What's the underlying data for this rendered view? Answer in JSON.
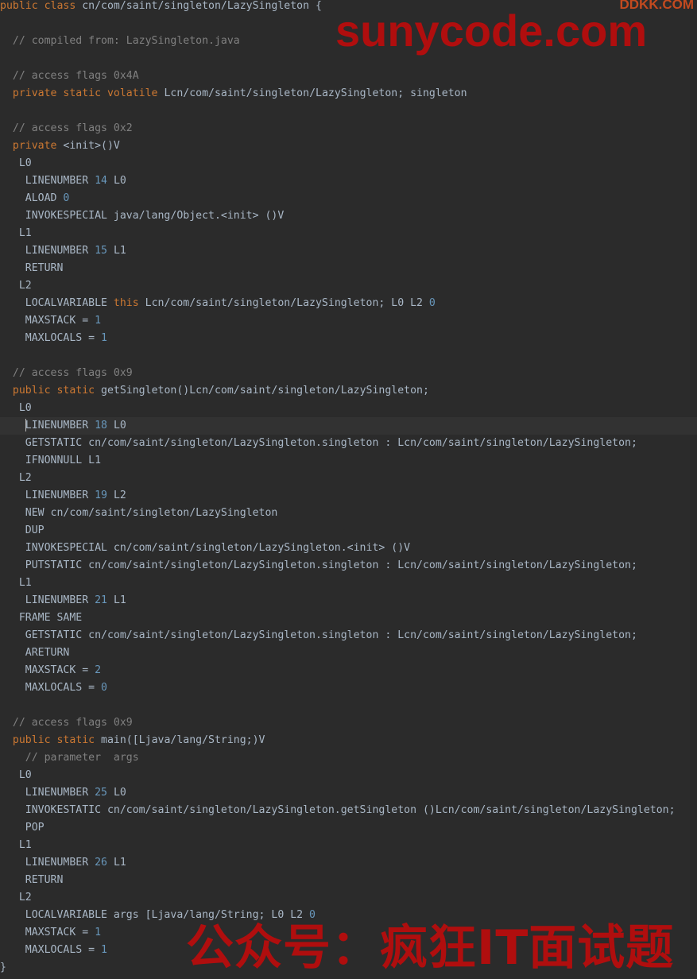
{
  "code": {
    "class_decl": {
      "kw": "public class",
      "rest": " cn/com/saint/singleton/LazySingleton {"
    },
    "compiled_from": "// compiled from: LazySingleton.java",
    "field": {
      "flags": "// access flags 0x4A",
      "kw": "private static volatile",
      "rest": " Lcn/com/saint/singleton/LazySingleton; singleton"
    },
    "init": {
      "flags": "// access flags 0x2",
      "kw": "private",
      "sig": " <init>()V",
      "l0": "L0",
      "ln14_text": "LINENUMBER ",
      "ln14_num": "14",
      "ln14_label": " L0",
      "aload_text": "ALOAD ",
      "aload_num": "0",
      "invokespecial": "INVOKESPECIAL java/lang/Object.<init> ()V",
      "l1": "L1",
      "ln15_text": "LINENUMBER ",
      "ln15_num": "15",
      "ln15_label": " L1",
      "return": "RETURN",
      "l2": "L2",
      "localvar_text": "LOCALVARIABLE ",
      "localvar_kw": "this",
      "localvar_rest": " Lcn/com/saint/singleton/LazySingleton; L0 L2 ",
      "localvar_num": "0",
      "maxstack_text": "MAXSTACK = ",
      "maxstack_num": "1",
      "maxlocals_text": "MAXLOCALS = ",
      "maxlocals_num": "1"
    },
    "get": {
      "flags": "// access flags 0x9",
      "kw": "public static",
      "sig": " getSingleton()Lcn/com/saint/singleton/LazySingleton;",
      "l0": "L0",
      "ln18_text": "LINENUMBER ",
      "ln18_num": "18",
      "ln18_label": " L0",
      "getstatic1": "GETSTATIC cn/com/saint/singleton/LazySingleton.singleton : Lcn/com/saint/singleton/LazySingleton;",
      "ifnonnull": "IFNONNULL L1",
      "l2": "L2",
      "ln19_text": "LINENUMBER ",
      "ln19_num": "19",
      "ln19_label": " L2",
      "new": "NEW cn/com/saint/singleton/LazySingleton",
      "dup": "DUP",
      "invokespecial": "INVOKESPECIAL cn/com/saint/singleton/LazySingleton.<init> ()V",
      "putstatic": "PUTSTATIC cn/com/saint/singleton/LazySingleton.singleton : Lcn/com/saint/singleton/LazySingleton;",
      "l1": "L1",
      "ln21_text": "LINENUMBER ",
      "ln21_num": "21",
      "ln21_label": " L1",
      "frame": "FRAME SAME",
      "getstatic2": "GETSTATIC cn/com/saint/singleton/LazySingleton.singleton : Lcn/com/saint/singleton/LazySingleton;",
      "areturn": "ARETURN",
      "maxstack_text": "MAXSTACK = ",
      "maxstack_num": "2",
      "maxlocals_text": "MAXLOCALS = ",
      "maxlocals_num": "0"
    },
    "main": {
      "flags": "// access flags 0x9",
      "kw": "public static",
      "sig": " main([Ljava/lang/String;)V",
      "param": "// parameter  args",
      "l0": "L0",
      "ln25_text": "LINENUMBER ",
      "ln25_num": "25",
      "ln25_label": " L0",
      "invokestatic": "INVOKESTATIC cn/com/saint/singleton/LazySingleton.getSingleton ()Lcn/com/saint/singleton/LazySingleton;",
      "pop": "POP",
      "l1": "L1",
      "ln26_text": "LINENUMBER ",
      "ln26_num": "26",
      "ln26_label": " L1",
      "return": "RETURN",
      "l2": "L2",
      "localvar_text": "LOCALVARIABLE args [Ljava/lang/String; L0 L2 ",
      "localvar_num": "0",
      "maxstack_text": "MAXSTACK = ",
      "maxstack_num": "1",
      "maxlocals_text": "MAXLOCALS = ",
      "maxlocals_num": "1"
    },
    "closing_brace": "}"
  },
  "watermarks": {
    "top": "sunycode.com",
    "corner": "DDKK.COM",
    "bottom": "公众号：疯狂IT面试题"
  },
  "colors": {
    "background": "#2b2b2b",
    "text": "#a9b7c6",
    "keyword": "#cc7832",
    "comment": "#808080",
    "number": "#6897bb",
    "current_line": "#323232",
    "watermark": "#b00e0e"
  }
}
